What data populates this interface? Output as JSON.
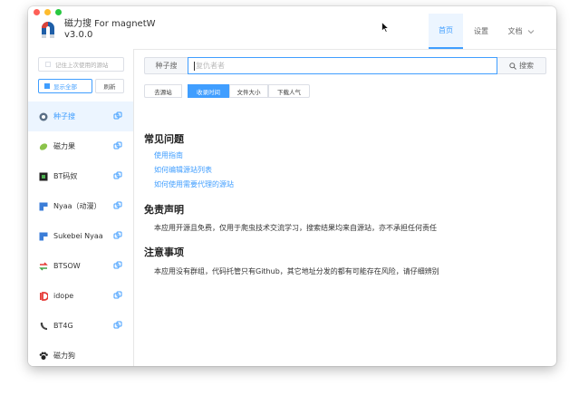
{
  "app": {
    "title": "磁力搜 For magnetW",
    "version": "v3.0.0"
  },
  "nav": {
    "home": "首页",
    "settings": "设置",
    "docs": "文档"
  },
  "sidebar": {
    "remember_label": "记住上次使用的源站",
    "show_all_label": "显示全部",
    "refresh_label": "刷新",
    "items": [
      {
        "label": "种子搜",
        "icon": "seed-search-icon"
      },
      {
        "label": "磁力果",
        "icon": "fruit-icon"
      },
      {
        "label": "BT码奴",
        "icon": "bt-mano-icon"
      },
      {
        "label": "Nyaa（动漫）",
        "icon": "nyaa-icon"
      },
      {
        "label": "Sukebei Nyaa",
        "icon": "sukebei-icon"
      },
      {
        "label": "BTSOW",
        "icon": "btsow-icon"
      },
      {
        "label": "idope",
        "icon": "idope-icon"
      },
      {
        "label": "BT4G",
        "icon": "bt4g-icon"
      },
      {
        "label": "磁力狗",
        "icon": "magnet-dog-icon"
      }
    ]
  },
  "search": {
    "source_label": "种子搜",
    "placeholder": "复仇者者",
    "button_label": "搜索"
  },
  "sort_tabs": [
    "去源站",
    "收录时间",
    "文件大小",
    "下载人气"
  ],
  "active_sort": "收录时间",
  "faq": {
    "title": "常见问题",
    "links": [
      "使用指南",
      "如何编辑源站列表",
      "如何使用需要代理的源站"
    ]
  },
  "disclaimer": {
    "title": "免责声明",
    "text": "本应用开源且免费，仅用于爬虫技术交流学习，搜索结果均来自源站，亦不承担任何责任"
  },
  "notice": {
    "title": "注意事项",
    "text": "本应用没有群组，代码托管只有Github，其它地址分发的都有可能存在风险，请仔细辨别"
  },
  "colors": {
    "accent": "#409eff",
    "active_bg": "#ecf5ff",
    "border": "#dcdfe6"
  }
}
